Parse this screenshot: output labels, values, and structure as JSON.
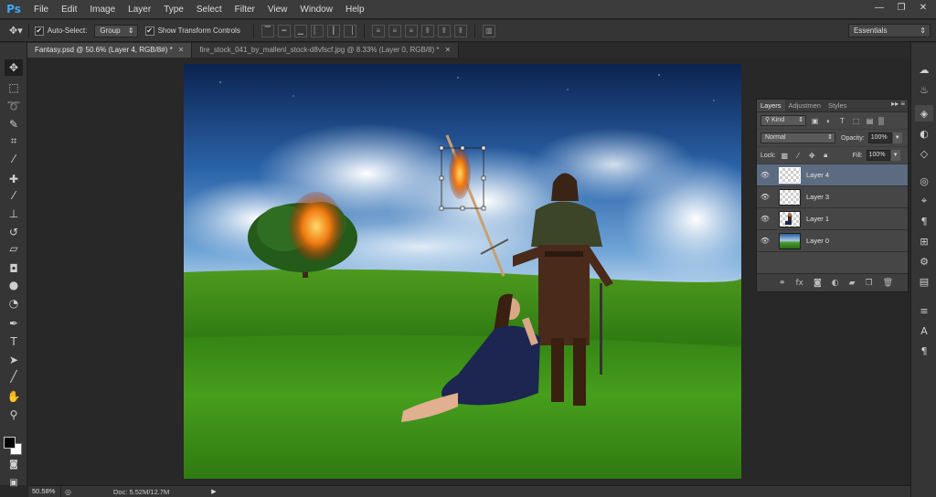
{
  "app": {
    "logo": "Ps"
  },
  "menu": [
    "File",
    "Edit",
    "Image",
    "Layer",
    "Type",
    "Select",
    "Filter",
    "View",
    "Window",
    "Help"
  ],
  "window_controls": {
    "minimize": "—",
    "restore": "❐",
    "close": "✕"
  },
  "options": {
    "auto_select_label": "Auto-Select:",
    "auto_select_checked": true,
    "auto_select_value": "Group",
    "transform_label": "Show Transform Controls",
    "transform_checked": true,
    "workspace": "Essentials"
  },
  "tabs": [
    {
      "label": "Fantasy.psd @ 50.6% (Layer 4, RGB/8#) *",
      "active": true
    },
    {
      "label": "fire_stock_041_by_mallenl_stock-d8vfscf.jpg @ 8.33% (Layer 0, RGB/8) *",
      "active": false
    }
  ],
  "tools": [
    {
      "name": "move-tool",
      "glyph": "✥",
      "selected": true
    },
    {
      "name": "marquee-tool",
      "glyph": "⬚"
    },
    {
      "name": "lasso-tool",
      "glyph": "➰"
    },
    {
      "name": "quick-select-tool",
      "glyph": "✎"
    },
    {
      "name": "crop-tool",
      "glyph": "⌗"
    },
    {
      "name": "eyedropper-tool",
      "glyph": "⁄"
    },
    {
      "name": "healing-brush-tool",
      "glyph": "✚"
    },
    {
      "name": "brush-tool",
      "glyph": "⁄"
    },
    {
      "name": "clone-stamp-tool",
      "glyph": "⊥"
    },
    {
      "name": "history-brush-tool",
      "glyph": "↺"
    },
    {
      "name": "eraser-tool",
      "glyph": "▱"
    },
    {
      "name": "paint-bucket-tool",
      "glyph": "◘"
    },
    {
      "name": "blur-tool",
      "glyph": "●"
    },
    {
      "name": "dodge-tool",
      "glyph": "◔"
    },
    {
      "name": "pen-tool",
      "glyph": "✒"
    },
    {
      "name": "type-tool",
      "glyph": "T"
    },
    {
      "name": "path-select-tool",
      "glyph": "➤"
    },
    {
      "name": "line-tool",
      "glyph": "╱"
    },
    {
      "name": "hand-tool",
      "glyph": "✋"
    },
    {
      "name": "zoom-tool",
      "glyph": "⚲"
    }
  ],
  "layers_panel": {
    "tabs": [
      "Layers",
      "Adjustmen",
      "Styles"
    ],
    "filter_kind": "Kind",
    "blend_mode": "Normal",
    "opacity_label": "Opacity:",
    "opacity": "100%",
    "lock_label": "Lock:",
    "fill_label": "Fill:",
    "fill": "100%",
    "layers": [
      {
        "name": "Layer 4",
        "selected": true,
        "thumb": "transparent"
      },
      {
        "name": "Layer 3",
        "selected": false,
        "thumb": "transparent"
      },
      {
        "name": "Layer 1",
        "selected": false,
        "thumb": "figure"
      },
      {
        "name": "Layer 0",
        "selected": false,
        "thumb": "landscape"
      }
    ]
  },
  "status": {
    "zoom": "50.58%",
    "doc": "Doc: 5.52M/12.7M",
    "arrow": "▶"
  }
}
